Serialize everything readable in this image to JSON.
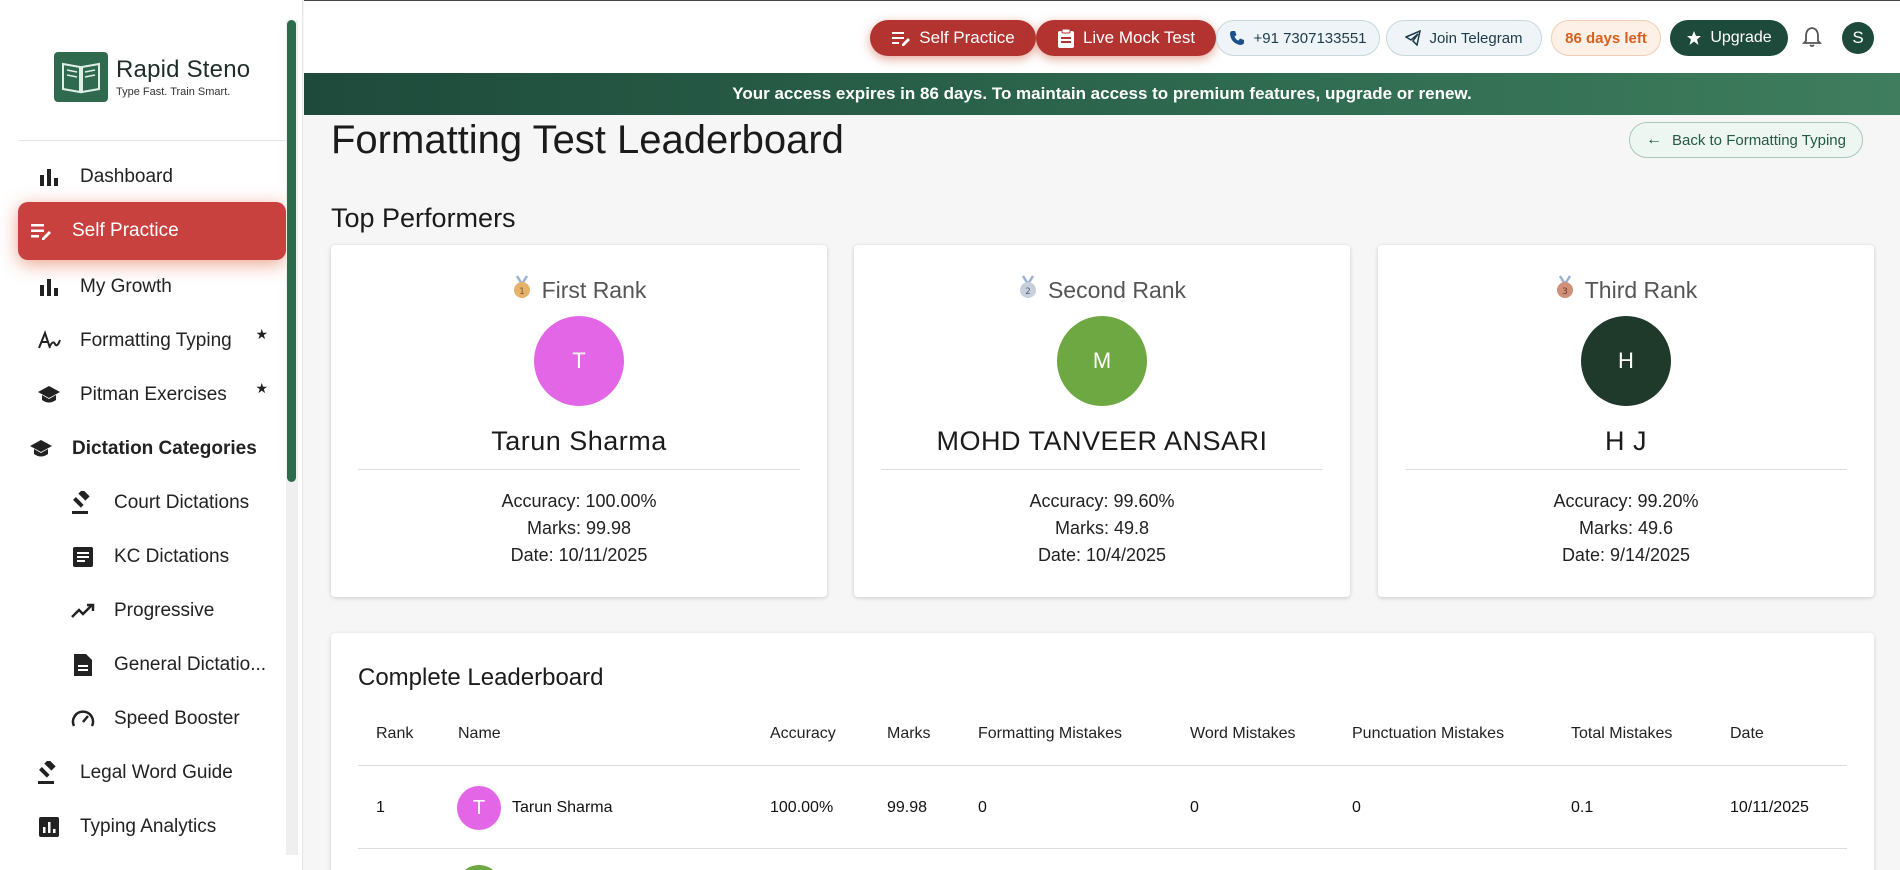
{
  "app": {
    "name": "Rapid Steno",
    "tagline": "Type Fast. Train Smart."
  },
  "sidebar": {
    "items": [
      {
        "label": "Dashboard",
        "icon": "bar-chart-icon"
      },
      {
        "label": "Self Practice",
        "icon": "edit-list-icon",
        "active": true
      },
      {
        "label": "My Growth",
        "icon": "bar-chart-icon"
      },
      {
        "label": "Formatting Typing",
        "icon": "signature-icon",
        "star": "★"
      },
      {
        "label": "Pitman Exercises",
        "icon": "graduation-cap-icon",
        "star": "★"
      },
      {
        "label": "Dictation Categories",
        "icon": "graduation-cap-icon"
      },
      {
        "label": "Court Dictations",
        "icon": "gavel-icon"
      },
      {
        "label": "KC Dictations",
        "icon": "article-icon"
      },
      {
        "label": "Progressive",
        "icon": "trending-up-icon"
      },
      {
        "label": "General Dictatio...",
        "icon": "document-icon"
      },
      {
        "label": "Speed Booster",
        "icon": "speedometer-icon"
      },
      {
        "label": "Legal Word Guide",
        "icon": "gavel-icon"
      },
      {
        "label": "Typing Analytics",
        "icon": "analytics-icon"
      }
    ]
  },
  "topbar": {
    "self_practice": "Self Practice",
    "live_mock": "Live Mock Test",
    "phone": "+91 7307133551",
    "telegram": "Join Telegram",
    "days_left": "86 days left",
    "upgrade": "Upgrade",
    "user_initial": "S"
  },
  "banner": "Your access expires in 86 days. To maintain access to premium features, upgrade or renew.",
  "main": {
    "title": "Formatting Test Leaderboard",
    "back": "Back to Formatting Typing",
    "top_title": "Top Performers",
    "top": [
      {
        "rank": "First Rank",
        "initial": "T",
        "name": "Tarun Sharma",
        "accuracy": "Accuracy: 100.00%",
        "marks": "Marks: 99.98",
        "date": "Date: 10/11/2025",
        "color": "#e366e7",
        "medal": "#e5b16b"
      },
      {
        "rank": "Second Rank",
        "initial": "M",
        "name": "MOHD TANVEER ANSARI",
        "accuracy": "Accuracy: 99.60%",
        "marks": "Marks: 49.8",
        "date": "Date: 10/4/2025",
        "color": "#6ea843",
        "medal": "#aab8cc"
      },
      {
        "rank": "Third Rank",
        "initial": "H",
        "name": "H J",
        "accuracy": "Accuracy: 99.20%",
        "marks": "Marks: 49.6",
        "date": "Date: 9/14/2025",
        "color": "#1f3a2a",
        "medal": "#d08f78"
      }
    ],
    "board_title": "Complete Leaderboard",
    "columns": [
      "Rank",
      "Name",
      "Accuracy",
      "Marks",
      "Formatting Mistakes",
      "Word Mistakes",
      "Punctuation Mistakes",
      "Total Mistakes",
      "Date"
    ],
    "rows": [
      {
        "rank": "1",
        "initial": "T",
        "name": "Tarun Sharma",
        "accuracy": "100.00%",
        "marks": "99.98",
        "formatting": "0",
        "word": "0",
        "punctuation": "0",
        "total": "0.1",
        "date": "10/11/2025"
      }
    ]
  }
}
